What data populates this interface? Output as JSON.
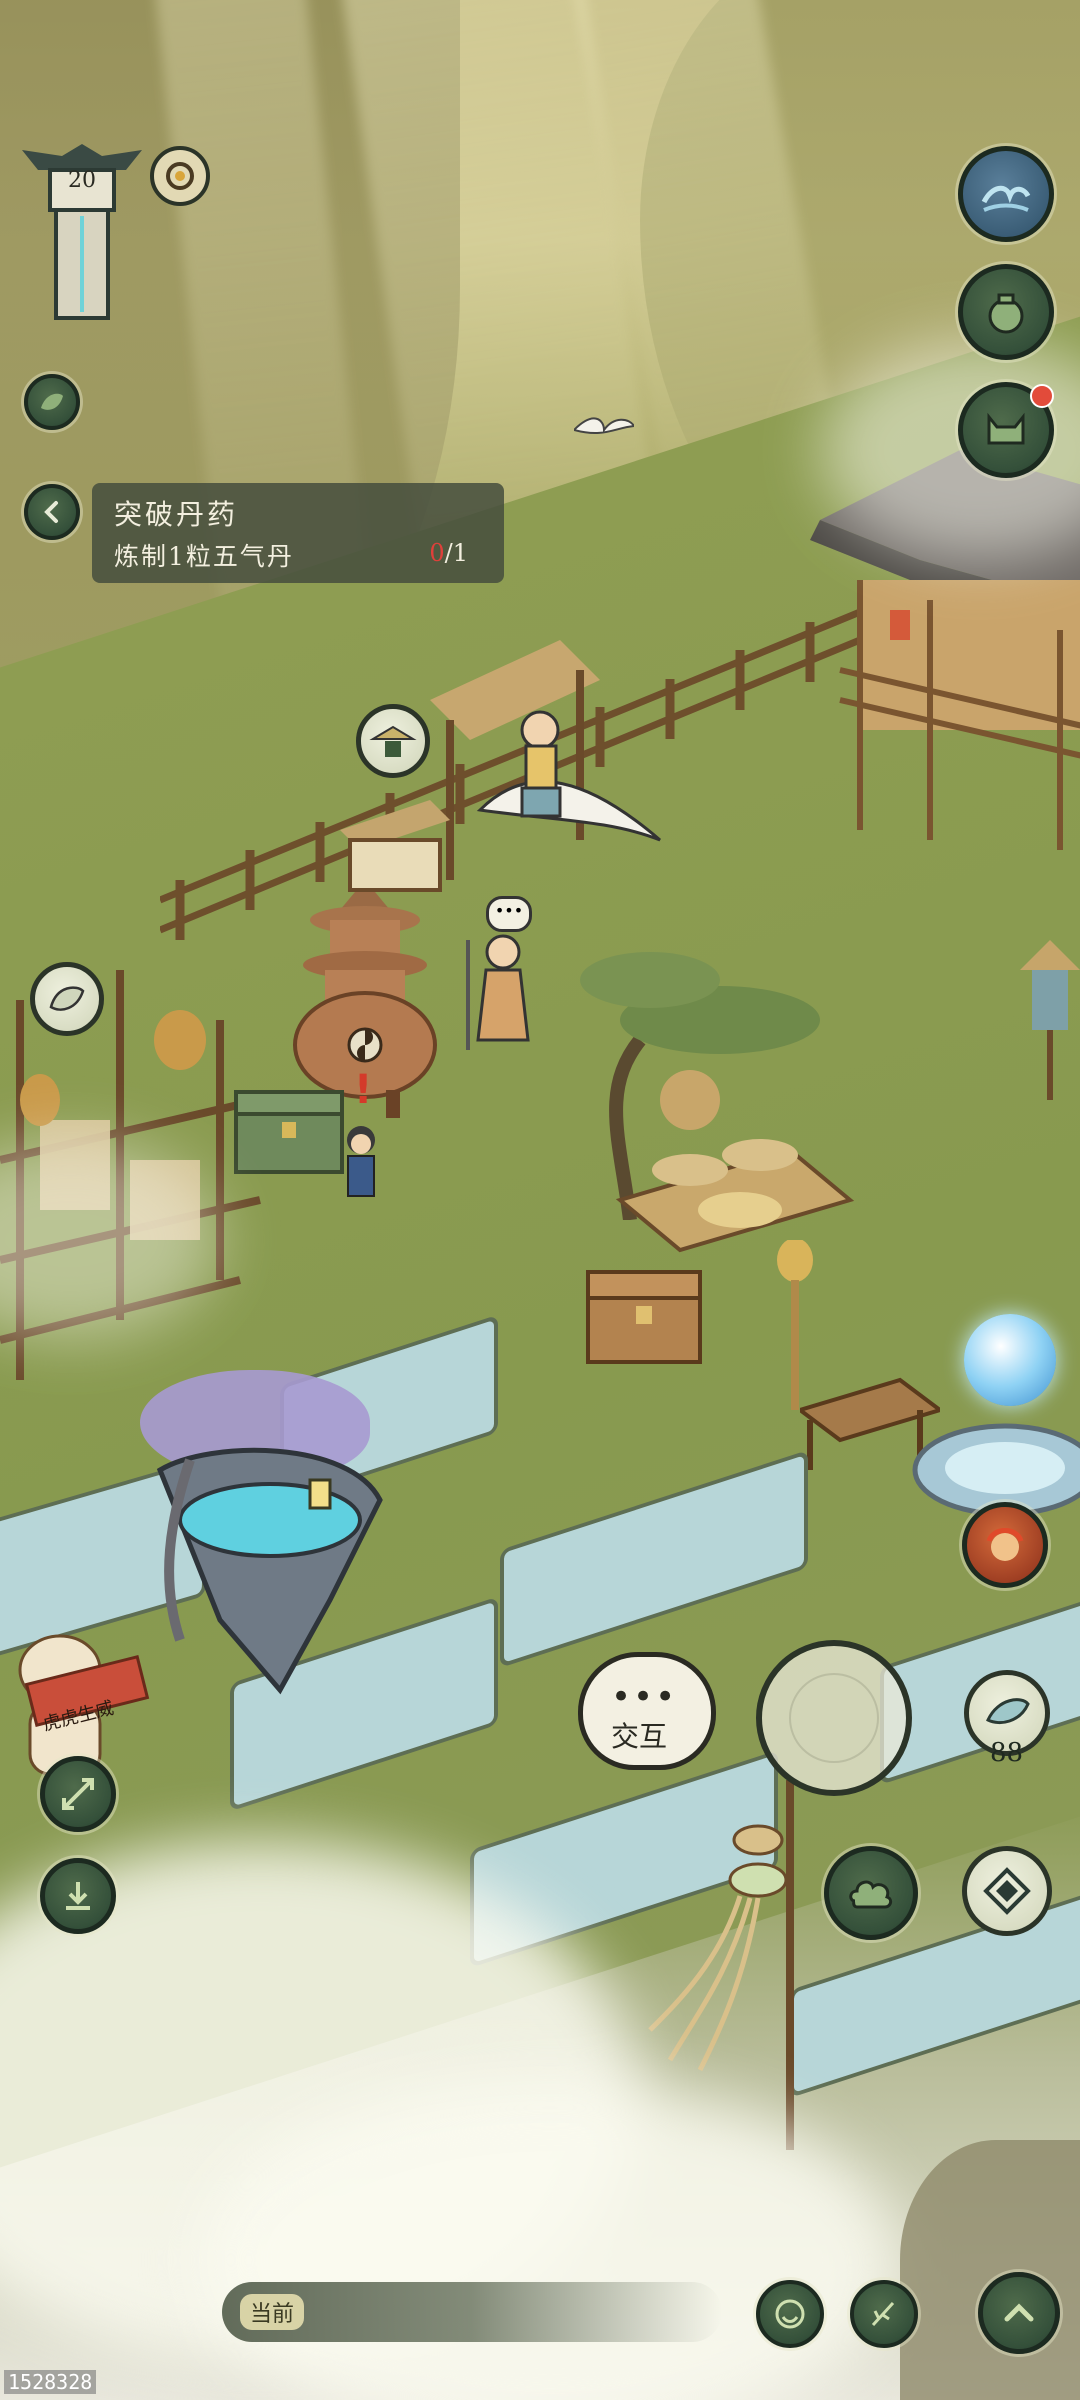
{
  "hud": {
    "level": "20"
  },
  "quest": {
    "title": "突破丹药",
    "desc": "炼制1粒五气丹",
    "progress_current": "0",
    "progress_sep": "/1"
  },
  "interact": {
    "dots": "•••",
    "label": "交互"
  },
  "right_buttons": {
    "spirit_count": "88"
  },
  "sign": {
    "text": "虎虎生威"
  },
  "bottom": {
    "current_label": "当前"
  },
  "watermark": "1528328",
  "colors": {
    "button_dark": "#34503a",
    "notification_red": "#e24b3a",
    "quest_panel": "#464e3e"
  },
  "icons": [
    "wave-icon",
    "bag-icon",
    "cat-mask-icon",
    "leaf-icon",
    "back-arrow-icon",
    "compass-icon",
    "cloud-icon",
    "diamond-icon",
    "expand-arrows-icon",
    "download-icon",
    "fruit-icon",
    "emoji-icon",
    "feather-pen-icon",
    "chevron-up-icon"
  ]
}
